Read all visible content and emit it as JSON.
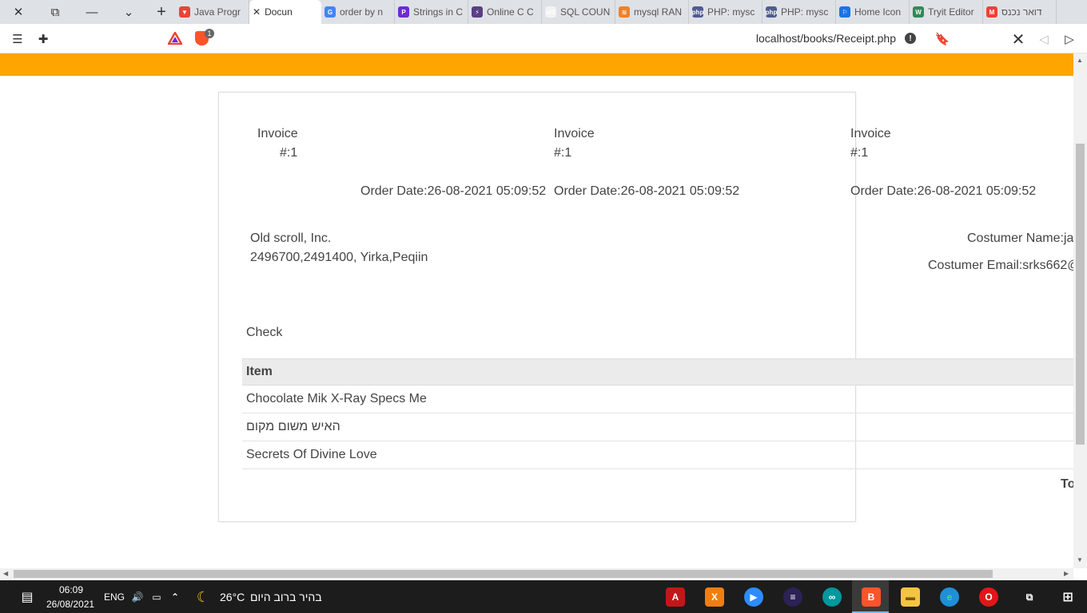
{
  "browser": {
    "tabs": [
      {
        "label": "Java Progr",
        "color": "#e8433a",
        "glyph": "▼"
      },
      {
        "label": "Docun",
        "color": "#ff6a00",
        "glyph": "",
        "active": true
      },
      {
        "label": "order by n",
        "color": "#4285f4",
        "glyph": "G"
      },
      {
        "label": "Strings in C",
        "color": "#6c2bd9",
        "glyph": "P"
      },
      {
        "label": "Online C C",
        "color": "#5a3e85",
        "glyph": "⚡"
      },
      {
        "label": "SQL COUN",
        "color": "#f2f2f2",
        "glyph": "w3"
      },
      {
        "label": "mysql RAN",
        "color": "#f48024",
        "glyph": "≋"
      },
      {
        "label": "PHP: mysc",
        "color": "#4f5b93",
        "glyph": "php"
      },
      {
        "label": "PHP: mysc",
        "color": "#4f5b93",
        "glyph": "php"
      },
      {
        "label": "Home Icon",
        "color": "#1a73e8",
        "glyph": "⚐"
      },
      {
        "label": "Tryit Editor",
        "color": "#2e8b57",
        "glyph": "W"
      },
      {
        "label": "דואר נכנס",
        "color": "#ea4335",
        "glyph": "M"
      }
    ],
    "shield_badge": "1",
    "url": "localhost/books/Receipt.php"
  },
  "invoice": {
    "columns": [
      {
        "heading": "Invoice",
        "number": "#:1",
        "order_date": "Order Date:26-08-2021 05:09:52"
      },
      {
        "heading": "Invoice",
        "number": "#:1",
        "order_date": "Order Date:26-08-2021 05:09:52"
      },
      {
        "heading": "Invoice",
        "number": "#:1",
        "order_date": "Order Date:26-08-2021 05:09:52"
      }
    ],
    "company_name": "Old scroll, Inc.",
    "company_address": "2496700,2491400, Yirka,Peqiin",
    "customer_name": "Costumer Name:ja",
    "customer_email": "Costumer Email:srks662@",
    "payment_method": "Check",
    "table_header": "Item",
    "items": [
      "Chocolate Mik X-Ray Specs Me",
      "האיש משום מקום",
      "Secrets Of Divine Love"
    ],
    "total_label": "To"
  },
  "taskbar": {
    "time": "06:09",
    "date": "26/08/2021",
    "language": "ENG",
    "temperature": "26°C",
    "weather": "בהיר ברוב היום"
  }
}
